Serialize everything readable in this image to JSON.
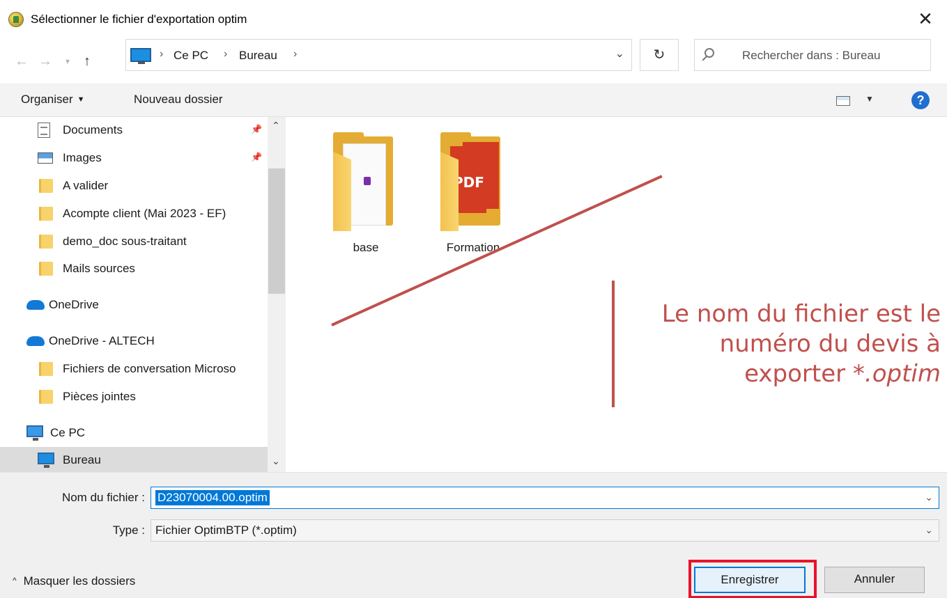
{
  "window": {
    "title": "Sélectionner le fichier d'exportation optim",
    "close": "✕"
  },
  "address": {
    "crumbs": [
      "Ce PC",
      "Bureau"
    ],
    "separator": "›"
  },
  "search": {
    "placeholder": "Rechercher dans : Bureau"
  },
  "toolbar": {
    "organize": "Organiser",
    "new_folder": "Nouveau dossier",
    "help": "?"
  },
  "nav": {
    "items": [
      {
        "label": "Documents",
        "icon": "document-icon",
        "pinned": true
      },
      {
        "label": "Images",
        "icon": "image-icon",
        "pinned": true
      },
      {
        "label": "A valider",
        "icon": "folder-icon"
      },
      {
        "label": "Acompte client (Mai 2023 - EF)",
        "icon": "folder-icon"
      },
      {
        "label": "demo_doc sous-traitant",
        "icon": "folder-icon"
      },
      {
        "label": "Mails sources",
        "icon": "folder-icon"
      },
      {
        "label": "OneDrive",
        "icon": "onedrive-icon"
      },
      {
        "label": "OneDrive - ALTECH",
        "icon": "onedrive-icon"
      },
      {
        "label": "Fichiers de conversation Microso",
        "icon": "folder-icon"
      },
      {
        "label": "Pièces jointes",
        "icon": "folder-icon"
      },
      {
        "label": "Ce PC",
        "icon": "pc-icon"
      },
      {
        "label": "Bureau",
        "icon": "desktop-icon",
        "selected": true
      }
    ]
  },
  "files": [
    {
      "name": "base",
      "icon": "folder-onenote-icon"
    },
    {
      "name": "Formation",
      "icon": "folder-pdf-icon"
    }
  ],
  "annotation": {
    "line1": "Le nom du fichier est le",
    "line2": "numéro du devis à",
    "line3_prefix": "exporter ",
    "line3_italic": "*.optim",
    "color": "#c0504d"
  },
  "form": {
    "filename_label": "Nom du fichier :",
    "filename_value": "D23070004.00.optim",
    "type_label": "Type :",
    "type_value": "Fichier OptimBTP (*.optim)"
  },
  "footer": {
    "hide_folders": "Masquer les dossiers",
    "save": "Enregistrer",
    "cancel": "Annuler",
    "highlight_color": "#e8132b"
  }
}
